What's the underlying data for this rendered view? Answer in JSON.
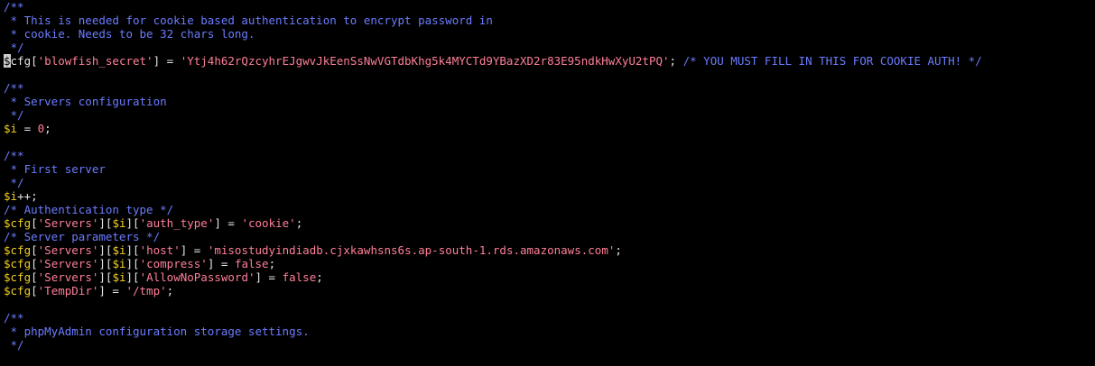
{
  "colors": {
    "background": "#000000",
    "comment": "#6b7cff",
    "variable": "#f0d020",
    "string": "#ff7f98",
    "plain": "#e4e4e4",
    "cursor": "#cfcfcf"
  },
  "lines": [
    [
      {
        "t": "cm",
        "v": "/**"
      }
    ],
    [
      {
        "t": "cm",
        "v": " * This is needed for cookie based authentication to encrypt password in"
      }
    ],
    [
      {
        "t": "cm",
        "v": " * cookie. Needs to be 32 chars long."
      }
    ],
    [
      {
        "t": "cm",
        "v": " */"
      }
    ],
    [
      {
        "t": "cursor",
        "v": "$"
      },
      {
        "t": "pl",
        "v": "cfg["
      },
      {
        "t": "st",
        "v": "'blowfish_secret'"
      },
      {
        "t": "pl",
        "v": "] = "
      },
      {
        "t": "st",
        "v": "'Ytj4h62rQzcyhrEJgwvJkEenSsNwVGTdbKhg5k4MYCTd9YBazXD2r83E95ndkHwXyU2tPQ'"
      },
      {
        "t": "pl",
        "v": "; "
      },
      {
        "t": "cm",
        "v": "/* YOU MUST FILL IN THIS FOR COOKIE AUTH! */"
      }
    ],
    [],
    [
      {
        "t": "cm",
        "v": "/**"
      }
    ],
    [
      {
        "t": "cm",
        "v": " * Servers configuration"
      }
    ],
    [
      {
        "t": "cm",
        "v": " */"
      }
    ],
    [
      {
        "t": "vr",
        "v": "$i"
      },
      {
        "t": "pl",
        "v": " = "
      },
      {
        "t": "num",
        "v": "0"
      },
      {
        "t": "pl",
        "v": ";"
      }
    ],
    [],
    [
      {
        "t": "cm",
        "v": "/**"
      }
    ],
    [
      {
        "t": "cm",
        "v": " * First server"
      }
    ],
    [
      {
        "t": "cm",
        "v": " */"
      }
    ],
    [
      {
        "t": "vr",
        "v": "$i"
      },
      {
        "t": "pl",
        "v": "++;"
      }
    ],
    [
      {
        "t": "cm",
        "v": "/* Authentication type */"
      }
    ],
    [
      {
        "t": "vr",
        "v": "$cfg"
      },
      {
        "t": "pl",
        "v": "["
      },
      {
        "t": "st",
        "v": "'Servers'"
      },
      {
        "t": "pl",
        "v": "]["
      },
      {
        "t": "vr",
        "v": "$i"
      },
      {
        "t": "pl",
        "v": "]["
      },
      {
        "t": "st",
        "v": "'auth_type'"
      },
      {
        "t": "pl",
        "v": "] = "
      },
      {
        "t": "st",
        "v": "'cookie'"
      },
      {
        "t": "pl",
        "v": ";"
      }
    ],
    [
      {
        "t": "cm",
        "v": "/* Server parameters */"
      }
    ],
    [
      {
        "t": "vr",
        "v": "$cfg"
      },
      {
        "t": "pl",
        "v": "["
      },
      {
        "t": "st",
        "v": "'Servers'"
      },
      {
        "t": "pl",
        "v": "]["
      },
      {
        "t": "vr",
        "v": "$i"
      },
      {
        "t": "pl",
        "v": "]["
      },
      {
        "t": "st",
        "v": "'host'"
      },
      {
        "t": "pl",
        "v": "] = "
      },
      {
        "t": "st",
        "v": "'misostudyindiadb.cjxkawhsns6s.ap-south-1.rds.amazonaws.com'"
      },
      {
        "t": "pl",
        "v": ";"
      }
    ],
    [
      {
        "t": "vr",
        "v": "$cfg"
      },
      {
        "t": "pl",
        "v": "["
      },
      {
        "t": "st",
        "v": "'Servers'"
      },
      {
        "t": "pl",
        "v": "]["
      },
      {
        "t": "vr",
        "v": "$i"
      },
      {
        "t": "pl",
        "v": "]["
      },
      {
        "t": "st",
        "v": "'compress'"
      },
      {
        "t": "pl",
        "v": "] = "
      },
      {
        "t": "kw",
        "v": "false"
      },
      {
        "t": "pl",
        "v": ";"
      }
    ],
    [
      {
        "t": "vr",
        "v": "$cfg"
      },
      {
        "t": "pl",
        "v": "["
      },
      {
        "t": "st",
        "v": "'Servers'"
      },
      {
        "t": "pl",
        "v": "]["
      },
      {
        "t": "vr",
        "v": "$i"
      },
      {
        "t": "pl",
        "v": "]["
      },
      {
        "t": "st",
        "v": "'AllowNoPassword'"
      },
      {
        "t": "pl",
        "v": "] = "
      },
      {
        "t": "kw",
        "v": "false"
      },
      {
        "t": "pl",
        "v": ";"
      }
    ],
    [
      {
        "t": "vr",
        "v": "$cfg"
      },
      {
        "t": "pl",
        "v": "["
      },
      {
        "t": "st",
        "v": "'TempDir'"
      },
      {
        "t": "pl",
        "v": "] = "
      },
      {
        "t": "st",
        "v": "'/tmp'"
      },
      {
        "t": "pl",
        "v": ";"
      }
    ],
    [],
    [
      {
        "t": "cm",
        "v": "/**"
      }
    ],
    [
      {
        "t": "cm",
        "v": " * phpMyAdmin configuration storage settings."
      }
    ],
    [
      {
        "t": "cm",
        "v": " */"
      }
    ]
  ]
}
